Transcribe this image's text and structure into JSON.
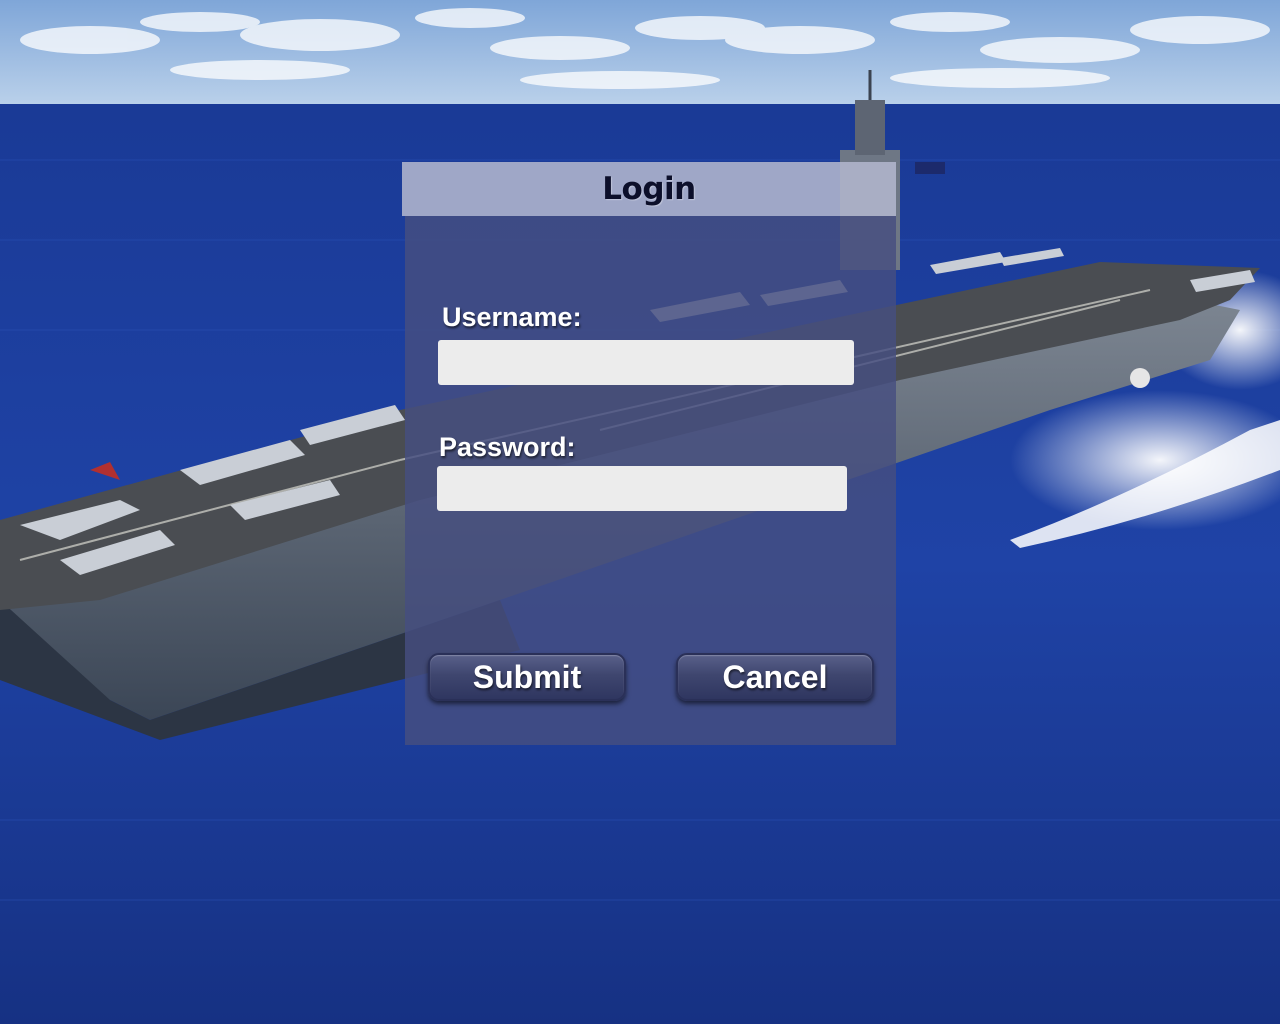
{
  "background": {
    "image": "aircraft-carrier-at-sea",
    "colors": {
      "sky": "#8fb4dc",
      "ocean": "#1d3f9a",
      "deep_ocean": "#162e7a"
    }
  },
  "dialog": {
    "title": "Login",
    "username_label": "Username:",
    "username_value": "",
    "password_label": "Password:",
    "password_value": "",
    "submit_label": "Submit",
    "cancel_label": "Cancel",
    "colors": {
      "header": "#b2b6cd",
      "body": "#464e80",
      "input": "#ececec",
      "button": "#3f466f"
    }
  }
}
